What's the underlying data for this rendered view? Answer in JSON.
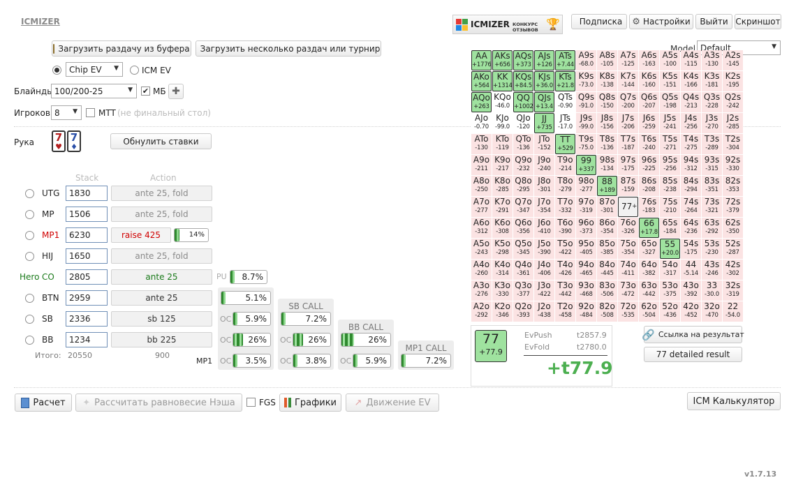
{
  "app": {
    "name": "ICMIZER",
    "version": "v1.7.13"
  },
  "banner": {
    "brand": "ICMIZER",
    "text": "КОНКУРС ОТЗЫВОВ"
  },
  "topbar": {
    "subscribe": "Подписка",
    "settings": "Настройки",
    "logout": "Выйти",
    "screenshot": "Скриншот"
  },
  "load": {
    "from_buffer": "Загрузить раздачу из буфера",
    "multi": "Загрузить несколько раздач или турнир"
  },
  "model": {
    "label": "Model",
    "value": "Default"
  },
  "ev": {
    "chip": "Chip EV",
    "icm": "ICM EV"
  },
  "blinds": {
    "label": "Блайнды",
    "value": "100/200-25",
    "mb": "МБ"
  },
  "players": {
    "label": "Игроков",
    "value": "8",
    "mtt": "MTT",
    "mtt_hint": "(не финальный стол)"
  },
  "hand": {
    "label": "Рука",
    "card1": "7",
    "card2": "7",
    "reset": "Обнулить ставки"
  },
  "table_head": {
    "stack": "Stack",
    "action": "Action"
  },
  "positions": [
    {
      "pos": "UTG",
      "stack": "1830",
      "action": "ante 25, fold"
    },
    {
      "pos": "MP",
      "stack": "1506",
      "action": "ante 25, fold"
    },
    {
      "pos": "MP1",
      "stack": "6230",
      "action": "raise 425",
      "pct": "14%",
      "pct_value": 14
    },
    {
      "pos": "HIJ",
      "stack": "1650",
      "action": "ante 25, fold"
    },
    {
      "hero": "Hero",
      "pos": "CO",
      "stack": "2805",
      "action": "ante 25",
      "pu": "PU",
      "pct": "8.7%",
      "pct_value": 8.7
    },
    {
      "pos": "BTN",
      "stack": "2959",
      "action": "ante 25",
      "pct": "5.1%",
      "pct_value": 5.1
    },
    {
      "pos": "SB",
      "stack": "2336",
      "action": "sb 125",
      "pct": "5.9%",
      "pct_value": 5.9
    },
    {
      "pos": "BB",
      "stack": "1234",
      "action": "bb 225",
      "pct": "26%",
      "pct_value": 26
    }
  ],
  "totals": {
    "label": "Итого:",
    "stack": "20550",
    "action": "900",
    "mp1": "MP1"
  },
  "calls": {
    "oc": "OC",
    "sb_call": {
      "title": "SB CALL",
      "vs_co": "7.2%",
      "vs_co_value": 7.2,
      "vs_bb": "26%",
      "vs_bb_value": 26,
      "vs_mp1": "3.8%",
      "vs_mp1_value": 3.8
    },
    "bb_call": {
      "title": "BB CALL",
      "vs_co": "26%",
      "vs_co_value": 26,
      "vs_mp1": "5.9%",
      "vs_mp1_value": 5.9
    },
    "mp1_call": {
      "title": "MP1 CALL",
      "vs_co": "7.2%",
      "vs_co_value": 7.2
    },
    "btn_vs_mp1": "3.5%",
    "btn_vs_mp1_value": 3.5
  },
  "result": {
    "hand": "77",
    "ev": "+77.9",
    "evpush_label": "EvPush",
    "evpush": "t2857.9",
    "evfold_label": "EvFold",
    "evfold": "t2780.0",
    "big": "+t77.9",
    "link": "Ссылка на результат",
    "detailed": "77 detailed result"
  },
  "bottom": {
    "calc": "Расчет",
    "nash": "Рассчитать равновесие Нэша",
    "fgs": "FGS",
    "charts": "Графики",
    "ev_move": "Движение EV",
    "icm_calc": "ICM Калькулятор"
  },
  "colors": {
    "push": "#9fe29f",
    "fold": "#fbe3e3",
    "accent_green": "#4caf50",
    "red": "#d00000",
    "hero_green": "#1a7a1a"
  },
  "grid": [
    [
      [
        "AA",
        "+1776",
        "p"
      ],
      [
        "AKs",
        "+656",
        "p"
      ],
      [
        "AQs",
        "+373",
        "p"
      ],
      [
        "AJs",
        "+126",
        "p"
      ],
      [
        "ATs",
        "+7.44",
        "p"
      ],
      [
        "A9s",
        "-68.0",
        "f"
      ],
      [
        "A8s",
        "-105",
        "f"
      ],
      [
        "A7s",
        "-125",
        "f"
      ],
      [
        "A6s",
        "-163",
        "f"
      ],
      [
        "A5s",
        "-100",
        "f"
      ],
      [
        "A4s",
        "-115",
        "f"
      ],
      [
        "A3s",
        "-130",
        "f"
      ],
      [
        "A2s",
        "-145",
        "f"
      ]
    ],
    [
      [
        "AKo",
        "+564",
        "p"
      ],
      [
        "KK",
        "+1314",
        "p"
      ],
      [
        "KQs",
        "+84.5",
        "p"
      ],
      [
        "KJs",
        "+36.0",
        "p"
      ],
      [
        "KTs",
        "+21.8",
        "p"
      ],
      [
        "K9s",
        "-73.0",
        "f"
      ],
      [
        "K8s",
        "-138",
        "f"
      ],
      [
        "K7s",
        "-144",
        "f"
      ],
      [
        "K6s",
        "-160",
        "f"
      ],
      [
        "K5s",
        "-151",
        "f"
      ],
      [
        "K4s",
        "-166",
        "f"
      ],
      [
        "K3s",
        "-181",
        "f"
      ],
      [
        "K2s",
        "-195",
        "f"
      ]
    ],
    [
      [
        "AQo",
        "+263",
        "p"
      ],
      [
        "KQo",
        "-46.0",
        "n"
      ],
      [
        "QQ",
        "+1002",
        "p"
      ],
      [
        "QJs",
        "+13.4",
        "p"
      ],
      [
        "QTs",
        "-0.90",
        "n"
      ],
      [
        "Q9s",
        "-91.0",
        "f"
      ],
      [
        "Q8s",
        "-150",
        "f"
      ],
      [
        "Q7s",
        "-200",
        "f"
      ],
      [
        "Q6s",
        "-207",
        "f"
      ],
      [
        "Q5s",
        "-198",
        "f"
      ],
      [
        "Q4s",
        "-213",
        "f"
      ],
      [
        "Q3s",
        "-228",
        "f"
      ],
      [
        "Q2s",
        "-242",
        "f"
      ]
    ],
    [
      [
        "AJo",
        "-0.70",
        "n"
      ],
      [
        "KJo",
        "-99.0",
        "n"
      ],
      [
        "QJo",
        "-120",
        "n"
      ],
      [
        "JJ",
        "+735",
        "p"
      ],
      [
        "JTs",
        "-17.0",
        "n"
      ],
      [
        "J9s",
        "-99.0",
        "f"
      ],
      [
        "J8s",
        "-156",
        "f"
      ],
      [
        "J7s",
        "-206",
        "f"
      ],
      [
        "J6s",
        "-259",
        "f"
      ],
      [
        "J5s",
        "-241",
        "f"
      ],
      [
        "J4s",
        "-256",
        "f"
      ],
      [
        "J3s",
        "-270",
        "f"
      ],
      [
        "J2s",
        "-285",
        "f"
      ]
    ],
    [
      [
        "ATo",
        "-130",
        "f"
      ],
      [
        "KTo",
        "-119",
        "f"
      ],
      [
        "QTo",
        "-136",
        "f"
      ],
      [
        "JTo",
        "-152",
        "f"
      ],
      [
        "TT",
        "+529",
        "p"
      ],
      [
        "T9s",
        "-75.0",
        "f"
      ],
      [
        "T8s",
        "-136",
        "f"
      ],
      [
        "T7s",
        "-187",
        "f"
      ],
      [
        "T6s",
        "-240",
        "f"
      ],
      [
        "T5s",
        "-271",
        "f"
      ],
      [
        "T4s",
        "-275",
        "f"
      ],
      [
        "T3s",
        "-289",
        "f"
      ],
      [
        "T2s",
        "-304",
        "f"
      ]
    ],
    [
      [
        "A9o",
        "-211",
        "f"
      ],
      [
        "K9o",
        "-217",
        "f"
      ],
      [
        "Q9o",
        "-232",
        "f"
      ],
      [
        "J9o",
        "-240",
        "f"
      ],
      [
        "T9o",
        "-214",
        "f"
      ],
      [
        "99",
        "+337",
        "p"
      ],
      [
        "98s",
        "-134",
        "f"
      ],
      [
        "97s",
        "-175",
        "f"
      ],
      [
        "96s",
        "-225",
        "f"
      ],
      [
        "95s",
        "-256",
        "f"
      ],
      [
        "94s",
        "-312",
        "f"
      ],
      [
        "93s",
        "-315",
        "f"
      ],
      [
        "92s",
        "-330",
        "f"
      ]
    ],
    [
      [
        "A8o",
        "-250",
        "f"
      ],
      [
        "K8o",
        "-285",
        "f"
      ],
      [
        "Q8o",
        "-295",
        "f"
      ],
      [
        "J8o",
        "-301",
        "f"
      ],
      [
        "T8o",
        "-279",
        "f"
      ],
      [
        "98o",
        "-277",
        "f"
      ],
      [
        "88",
        "+189",
        "p"
      ],
      [
        "87s",
        "-159",
        "f"
      ],
      [
        "86s",
        "-208",
        "f"
      ],
      [
        "85s",
        "-238",
        "f"
      ],
      [
        "84s",
        "-294",
        "f"
      ],
      [
        "83s",
        "-351",
        "f"
      ],
      [
        "82s",
        "-353",
        "f"
      ]
    ],
    [
      [
        "A7o",
        "-277",
        "f"
      ],
      [
        "K7o",
        "-291",
        "f"
      ],
      [
        "Q7o",
        "-347",
        "f"
      ],
      [
        "J7o",
        "-354",
        "f"
      ],
      [
        "T7o",
        "-332",
        "f"
      ],
      [
        "97o",
        "-319",
        "f"
      ],
      [
        "87o",
        "-301",
        "f"
      ],
      [
        "77",
        "+77.9",
        "s"
      ],
      [
        "76s",
        "-183",
        "f"
      ],
      [
        "75s",
        "-210",
        "f"
      ],
      [
        "74s",
        "-264",
        "f"
      ],
      [
        "73s",
        "-321",
        "f"
      ],
      [
        "72s",
        "-379",
        "f"
      ]
    ],
    [
      [
        "A6o",
        "-312",
        "f"
      ],
      [
        "K6o",
        "-308",
        "f"
      ],
      [
        "Q6o",
        "-356",
        "f"
      ],
      [
        "J6o",
        "-410",
        "f"
      ],
      [
        "T6o",
        "-390",
        "f"
      ],
      [
        "96o",
        "-373",
        "f"
      ],
      [
        "86o",
        "-354",
        "f"
      ],
      [
        "76o",
        "-326",
        "f"
      ],
      [
        "66",
        "+17.8",
        "p"
      ],
      [
        "65s",
        "-184",
        "f"
      ],
      [
        "64s",
        "-236",
        "f"
      ],
      [
        "63s",
        "-292",
        "f"
      ],
      [
        "62s",
        "-350",
        "f"
      ]
    ],
    [
      [
        "A5o",
        "-243",
        "f"
      ],
      [
        "K5o",
        "-298",
        "f"
      ],
      [
        "Q5o",
        "-345",
        "f"
      ],
      [
        "J5o",
        "-390",
        "f"
      ],
      [
        "T5o",
        "-422",
        "f"
      ],
      [
        "95o",
        "-405",
        "f"
      ],
      [
        "85o",
        "-385",
        "f"
      ],
      [
        "75o",
        "-354",
        "f"
      ],
      [
        "65o",
        "-327",
        "f"
      ],
      [
        "55",
        "+20.0",
        "p"
      ],
      [
        "54s",
        "-175",
        "f"
      ],
      [
        "53s",
        "-230",
        "f"
      ],
      [
        "52s",
        "-287",
        "f"
      ]
    ],
    [
      [
        "A4o",
        "-260",
        "f"
      ],
      [
        "K4o",
        "-314",
        "f"
      ],
      [
        "Q4o",
        "-361",
        "f"
      ],
      [
        "J4o",
        "-406",
        "f"
      ],
      [
        "T4o",
        "-426",
        "f"
      ],
      [
        "94o",
        "-465",
        "f"
      ],
      [
        "84o",
        "-445",
        "f"
      ],
      [
        "74o",
        "-411",
        "f"
      ],
      [
        "64o",
        "-382",
        "f"
      ],
      [
        "54o",
        "-317",
        "f"
      ],
      [
        "44",
        "-5.14",
        "f"
      ],
      [
        "43s",
        "-246",
        "f"
      ],
      [
        "42s",
        "-302",
        "f"
      ]
    ],
    [
      [
        "A3o",
        "-276",
        "f"
      ],
      [
        "K3o",
        "-330",
        "f"
      ],
      [
        "Q3o",
        "-377",
        "f"
      ],
      [
        "J3o",
        "-422",
        "f"
      ],
      [
        "T3o",
        "-442",
        "f"
      ],
      [
        "93o",
        "-468",
        "f"
      ],
      [
        "83o",
        "-506",
        "f"
      ],
      [
        "73o",
        "-472",
        "f"
      ],
      [
        "63o",
        "-442",
        "f"
      ],
      [
        "53o",
        "-375",
        "f"
      ],
      [
        "43o",
        "-392",
        "f"
      ],
      [
        "33",
        "-30.0",
        "f"
      ],
      [
        "32s",
        "-319",
        "f"
      ]
    ],
    [
      [
        "A2o",
        "-292",
        "f"
      ],
      [
        "K2o",
        "-346",
        "f"
      ],
      [
        "Q2o",
        "-393",
        "f"
      ],
      [
        "J2o",
        "-438",
        "f"
      ],
      [
        "T2o",
        "-458",
        "f"
      ],
      [
        "92o",
        "-484",
        "f"
      ],
      [
        "82o",
        "-508",
        "f"
      ],
      [
        "72o",
        "-535",
        "f"
      ],
      [
        "62o",
        "-504",
        "f"
      ],
      [
        "52o",
        "-436",
        "f"
      ],
      [
        "42o",
        "-452",
        "f"
      ],
      [
        "32o",
        "-470",
        "f"
      ],
      [
        "22",
        "-54.0",
        "f"
      ]
    ]
  ]
}
